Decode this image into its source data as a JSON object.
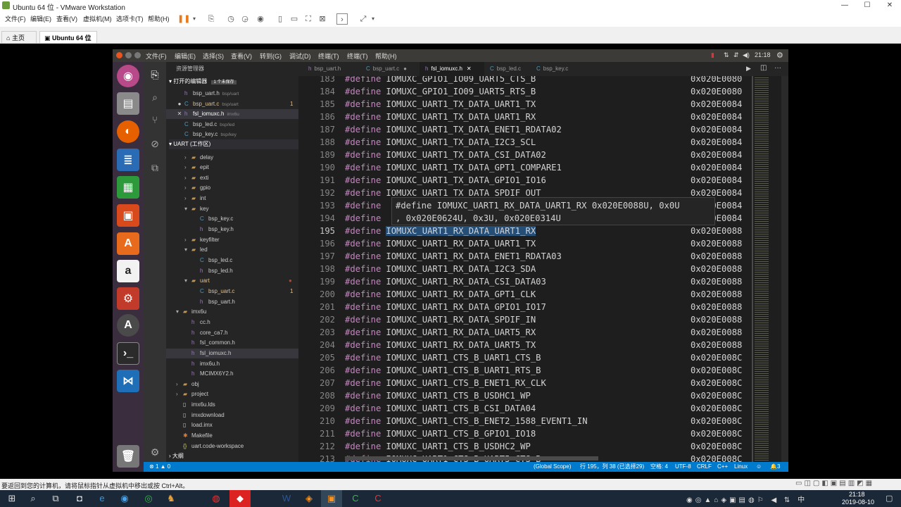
{
  "window": {
    "title": "Ubuntu 64 位 - VMware Workstation",
    "min": "—",
    "max": "☐",
    "close": "✕"
  },
  "menu": [
    "文件(F)",
    "编辑(E)",
    "查看(V)",
    "虚拟机(M)",
    "选项卡(T)",
    "帮助(H)"
  ],
  "vm_tabs": [
    {
      "label": "主页"
    },
    {
      "label": "Ubuntu 64 位"
    }
  ],
  "ubuntu_menu": [
    "文件(F)",
    "编辑(E)",
    "选择(S)",
    "查看(V)",
    "转到(G)",
    "调试(D)",
    "终端(T)",
    "终端(T)",
    "帮助(H)"
  ],
  "ubuntu_clock": "21:18",
  "sidebar": {
    "title": "资源管理器",
    "open_editors": "打开的编辑器",
    "unsaved": "1 个未保存",
    "open_files": [
      {
        "name": "bsp_uart.h",
        "path": "bsp/uart",
        "badge": "",
        "color": "#ccc",
        "icon": "h"
      },
      {
        "name": "bsp_uart.c",
        "path": "bsp/uart",
        "badge": "1",
        "color": "#e2c08d",
        "icon": "c"
      },
      {
        "name": "fsl_iomuxc.h",
        "path": "imx6u",
        "badge": "",
        "color": "#fff",
        "icon": "h"
      },
      {
        "name": "bsp_led.c",
        "path": "bsp/led",
        "badge": "",
        "color": "#ccc",
        "icon": "c"
      },
      {
        "name": "bsp_key.c",
        "path": "bsp/key",
        "badge": "",
        "color": "#ccc",
        "icon": "c"
      }
    ],
    "workspace": "UART (工作区)",
    "tree": [
      {
        "d": 1,
        "t": "delay",
        "f": true,
        "o": false
      },
      {
        "d": 1,
        "t": "epit",
        "f": true,
        "o": false
      },
      {
        "d": 1,
        "t": "exti",
        "f": true,
        "o": false
      },
      {
        "d": 1,
        "t": "gpio",
        "f": true,
        "o": false
      },
      {
        "d": 1,
        "t": "int",
        "f": true,
        "o": false
      },
      {
        "d": 1,
        "t": "key",
        "f": true,
        "o": true
      },
      {
        "d": 2,
        "t": "bsp_key.c",
        "f": false,
        "x": "c"
      },
      {
        "d": 2,
        "t": "bsp_key.h",
        "f": false,
        "x": "h"
      },
      {
        "d": 1,
        "t": "keyfilter",
        "f": true,
        "o": false
      },
      {
        "d": 1,
        "t": "led",
        "f": true,
        "o": true
      },
      {
        "d": 2,
        "t": "bsp_led.c",
        "f": false,
        "x": "c"
      },
      {
        "d": 2,
        "t": "bsp_led.h",
        "f": false,
        "x": "h"
      },
      {
        "d": 1,
        "t": "uart",
        "f": true,
        "o": true,
        "mod": true
      },
      {
        "d": 2,
        "t": "bsp_uart.c",
        "f": false,
        "x": "c",
        "mod": true,
        "badge": "1"
      },
      {
        "d": 2,
        "t": "bsp_uart.h",
        "f": false,
        "x": "h"
      },
      {
        "d": 0,
        "t": "imx6u",
        "f": true,
        "o": true
      },
      {
        "d": 1,
        "t": "cc.h",
        "f": false,
        "x": "h"
      },
      {
        "d": 1,
        "t": "core_ca7.h",
        "f": false,
        "x": "h"
      },
      {
        "d": 1,
        "t": "fsl_common.h",
        "f": false,
        "x": "h"
      },
      {
        "d": 1,
        "t": "fsl_iomuxc.h",
        "f": false,
        "x": "h",
        "sel": true
      },
      {
        "d": 1,
        "t": "imx6u.h",
        "f": false,
        "x": "h"
      },
      {
        "d": 1,
        "t": "MCIMX6Y2.h",
        "f": false,
        "x": "h"
      },
      {
        "d": 0,
        "t": "obj",
        "f": true,
        "o": false
      },
      {
        "d": 0,
        "t": "project",
        "f": true,
        "o": false
      },
      {
        "d": 0,
        "t": "imx6u.lds",
        "f": false,
        "x": "f"
      },
      {
        "d": 0,
        "t": "imxdownload",
        "f": false,
        "x": "f"
      },
      {
        "d": 0,
        "t": "load.imx",
        "f": false,
        "x": "f"
      },
      {
        "d": 0,
        "t": "Makefile",
        "f": false,
        "x": "m"
      },
      {
        "d": 0,
        "t": "uart.code-workspace",
        "f": false,
        "x": "w"
      }
    ],
    "outline": "大纲"
  },
  "editor_tabs": [
    {
      "label": "bsp_uart.h",
      "dot": ""
    },
    {
      "label": "bsp_uart.c",
      "dot": "●"
    },
    {
      "label": "fsl_iomuxc.h",
      "dot": "✕",
      "active": true
    },
    {
      "label": "bsp_led.c",
      "dot": ""
    },
    {
      "label": "bsp_key.c",
      "dot": ""
    }
  ],
  "code": [
    {
      "n": "183",
      "s": "IOMUXC_GPIO1_IO09_UART5_CTS_B",
      "h": "0x020E0080"
    },
    {
      "n": "184",
      "s": "IOMUXC_GPIO1_IO09_UART5_RTS_B",
      "h": "0x020E0080"
    },
    {
      "n": "185",
      "s": "IOMUXC_UART1_TX_DATA_UART1_TX",
      "h": "0x020E0084"
    },
    {
      "n": "186",
      "s": "IOMUXC_UART1_TX_DATA_UART1_RX",
      "h": "0x020E0084"
    },
    {
      "n": "187",
      "s": "IOMUXC_UART1_TX_DATA_ENET1_RDATA02",
      "h": "0x020E0084"
    },
    {
      "n": "188",
      "s": "IOMUXC_UART1_TX_DATA_I2C3_SCL",
      "h": "0x020E0084"
    },
    {
      "n": "189",
      "s": "IOMUXC_UART1_TX_DATA_CSI_DATA02",
      "h": "0x020E0084"
    },
    {
      "n": "190",
      "s": "IOMUXC_UART1_TX_DATA_GPT1_COMPARE1",
      "h": "0x020E0084"
    },
    {
      "n": "191",
      "s": "IOMUXC_UART1_TX_DATA_GPIO1_IO16",
      "h": "0x020E0084"
    },
    {
      "n": "192",
      "s": "IOMUXC_UART1_TX_DATA_SPDIF_OUT",
      "h": "0x020E0084"
    },
    {
      "n": "193",
      "s": "",
      "h": "0x020E0084"
    },
    {
      "n": "194",
      "s": "",
      "h": "0x020E0084"
    },
    {
      "n": "195",
      "s": "IOMUXC_UART1_RX_DATA_UART1_RX",
      "h": "0x020E0088"
    },
    {
      "n": "196",
      "s": "IOMUXC_UART1_RX_DATA_UART1_TX",
      "h": "0x020E0088"
    },
    {
      "n": "197",
      "s": "IOMUXC_UART1_RX_DATA_ENET1_RDATA03",
      "h": "0x020E0088"
    },
    {
      "n": "198",
      "s": "IOMUXC_UART1_RX_DATA_I2C3_SDA",
      "h": "0x020E0088"
    },
    {
      "n": "199",
      "s": "IOMUXC_UART1_RX_DATA_CSI_DATA03",
      "h": "0x020E0088"
    },
    {
      "n": "200",
      "s": "IOMUXC_UART1_RX_DATA_GPT1_CLK",
      "h": "0x020E0088"
    },
    {
      "n": "201",
      "s": "IOMUXC_UART1_RX_DATA_GPIO1_IO17",
      "h": "0x020E0088"
    },
    {
      "n": "202",
      "s": "IOMUXC_UART1_RX_DATA_SPDIF_IN",
      "h": "0x020E0088"
    },
    {
      "n": "203",
      "s": "IOMUXC_UART1_RX_DATA_UART5_RX",
      "h": "0x020E0088"
    },
    {
      "n": "204",
      "s": "IOMUXC_UART1_RX_DATA_UART5_TX",
      "h": "0x020E0088"
    },
    {
      "n": "205",
      "s": "IOMUXC_UART1_CTS_B_UART1_CTS_B",
      "h": "0x020E008C"
    },
    {
      "n": "206",
      "s": "IOMUXC_UART1_CTS_B_UART1_RTS_B",
      "h": "0x020E008C"
    },
    {
      "n": "207",
      "s": "IOMUXC_UART1_CTS_B_ENET1_RX_CLK",
      "h": "0x020E008C"
    },
    {
      "n": "208",
      "s": "IOMUXC_UART1_CTS_B_USDHC1_WP",
      "h": "0x020E008C"
    },
    {
      "n": "209",
      "s": "IOMUXC_UART1_CTS_B_CSI_DATA04",
      "h": "0x020E008C"
    },
    {
      "n": "210",
      "s": "IOMUXC_UART1_CTS_B_ENET2_1588_EVENT1_IN",
      "h": "0x020E008C"
    },
    {
      "n": "211",
      "s": "IOMUXC_UART1_CTS_B_GPIO1_IO18",
      "h": "0x020E008C"
    },
    {
      "n": "212",
      "s": "IOMUXC_UART1_CTS_B_USDHC2_WP",
      "h": "0x020E008C"
    },
    {
      "n": "213",
      "s": "IOMUXC_UART1_CTS_B_UART5_CTS_B",
      "h": "0x020E008C"
    }
  ],
  "define_kw": "#define",
  "hover": {
    "line1": "#define IOMUXC_UART1_RX_DATA_UART1_RX 0x020E0088U, 0x0U",
    "line2": ", 0x020E0624U, 0x3U, 0x020E0314U"
  },
  "status": {
    "errors": "1",
    "warnings": "0",
    "scope": "(Global Scope)",
    "pos": "行 195，列 38 (已选择29)",
    "spaces": "空格: 4",
    "enc": "UTF-8",
    "eol": "CRLF",
    "lang": "C++",
    "os": "Linux",
    "bell": "3"
  },
  "hint": "要返回到您的计算机，请将鼠标指针从虚拟机中移出或按 Ctrl+Alt。",
  "clock": {
    "time": "21:18",
    "date": "2019-08-10"
  },
  "colors": {
    "accent": "#007acc",
    "launcher": "#3a2d3d"
  }
}
